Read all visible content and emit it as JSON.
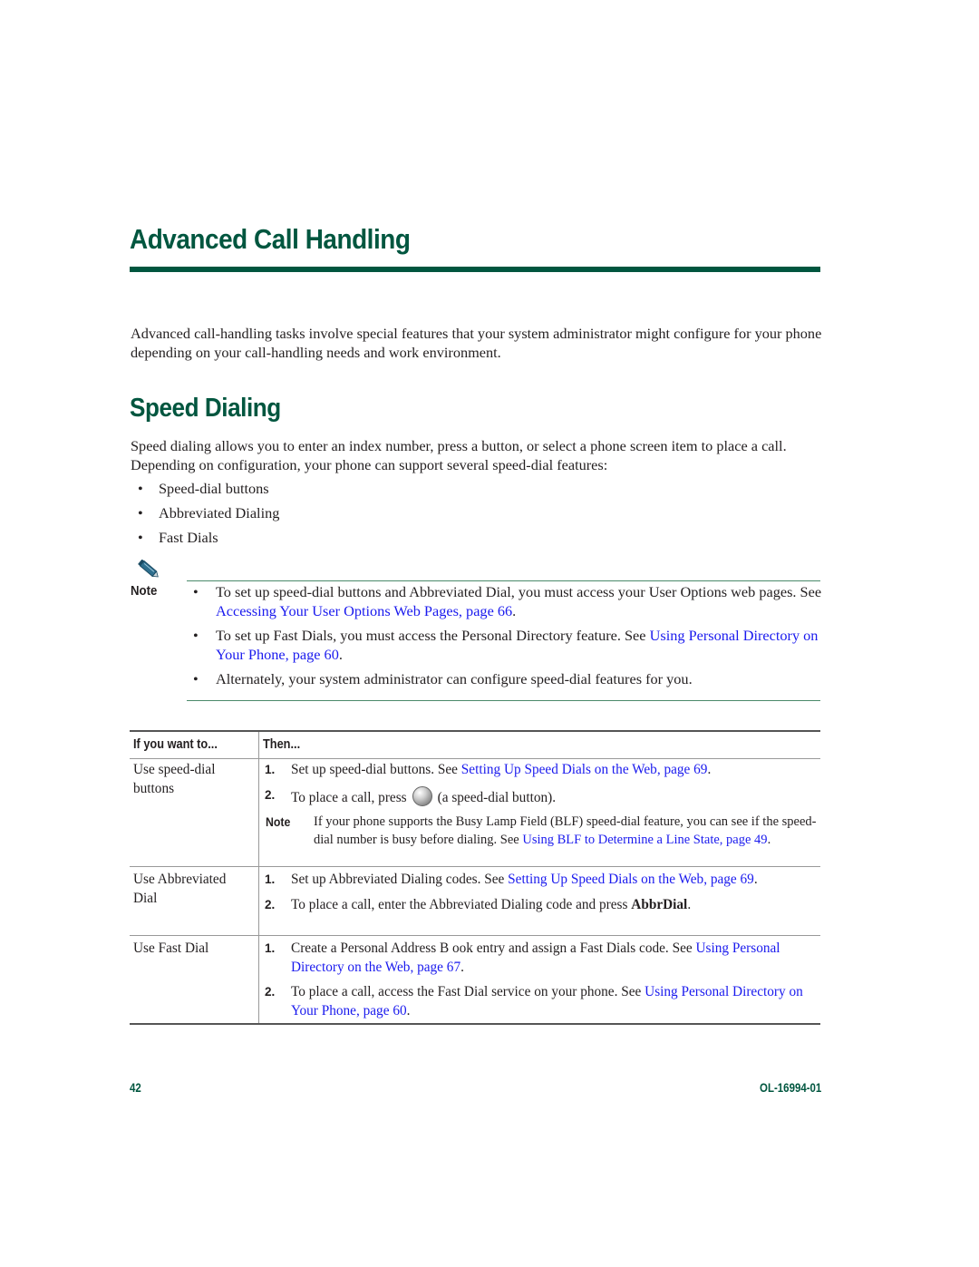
{
  "chapter": {
    "title": "Advanced Call Handling",
    "intro": "Advanced call-handling tasks involve special features that your system administrator might configure for your phone depending on your call-handling needs and work environment."
  },
  "section": {
    "title": "Speed Dialing",
    "body": "Speed dialing allows you to enter an index number, press a button, or select a phone screen item to place a call. Depending on configuration, your phone can support several speed-dial features:",
    "bullet_glyph": "•",
    "bullets": [
      "Speed-dial buttons",
      "Abbreviated Dialing",
      "Fast Dials"
    ]
  },
  "note": {
    "label": "Note",
    "icon": "pencil-icon",
    "items": [
      {
        "text": "To set up speed-dial buttons and Abbreviated Dial, you must access your User Options web pages. See ",
        "link": "Accessing Your User Options Web Pages, page 66",
        "after": "."
      },
      {
        "text": "To set up Fast Dials, you must access the Personal Directory feature. See ",
        "link": "Using Personal Directory on Your Phone, page 60",
        "after": "."
      },
      {
        "text": "Alternately, your system administrator can configure speed-dial features for you.",
        "link": "",
        "after": ""
      }
    ]
  },
  "table": {
    "headers": [
      "If you want to...",
      "Then..."
    ],
    "rows": [
      {
        "task": "Use speed-dial buttons",
        "steps": [
          {
            "num": "1.",
            "text": "Set up speed-dial buttons. See ",
            "link": "Setting Up Speed Dials on the Web, page 69",
            "after": "."
          },
          {
            "num": "2.",
            "text_before_icon": "To place a call, press",
            "icon": "speed-dial-button-icon",
            "text_after_icon": "(a speed-dial button)."
          }
        ],
        "note": {
          "label": "Note",
          "text": "If your phone supports the Busy Lamp Field (BLF) speed-dial feature, you can see if the speed-dial number is busy before dialing. See ",
          "link": "Using BLF to Determine a Line State, page 49",
          "after": "."
        }
      },
      {
        "task": "Use Abbreviated Dial",
        "steps": [
          {
            "num": "1.",
            "text": "Set up Abbreviated Dialing codes. See ",
            "link": "Setting Up Speed Dials on the Web, page 69",
            "after": "."
          },
          {
            "num": "2.",
            "text": "To place a call, enter the Abbreviated Dialing code and press ",
            "bold": "AbbrDial",
            "after": "."
          }
        ]
      },
      {
        "task": "Use Fast Dial",
        "steps": [
          {
            "num": "1.",
            "text": "Create a Personal Address B ook entry and assign a Fast Dials code. See ",
            "link": "Using Personal Directory on the Web, page 67",
            "after": "."
          },
          {
            "num": "2.",
            "text": "To place a call, access the Fast Dial service on your phone. See ",
            "link": "Using Personal Directory on Your Phone, page 60",
            "after": "."
          }
        ]
      }
    ]
  },
  "footer": {
    "page_number": "42",
    "doc_id": "OL-16994-01"
  },
  "colors": {
    "heading_green": "#00563f",
    "link_blue": "#1a1aee",
    "text": "#231f20"
  }
}
